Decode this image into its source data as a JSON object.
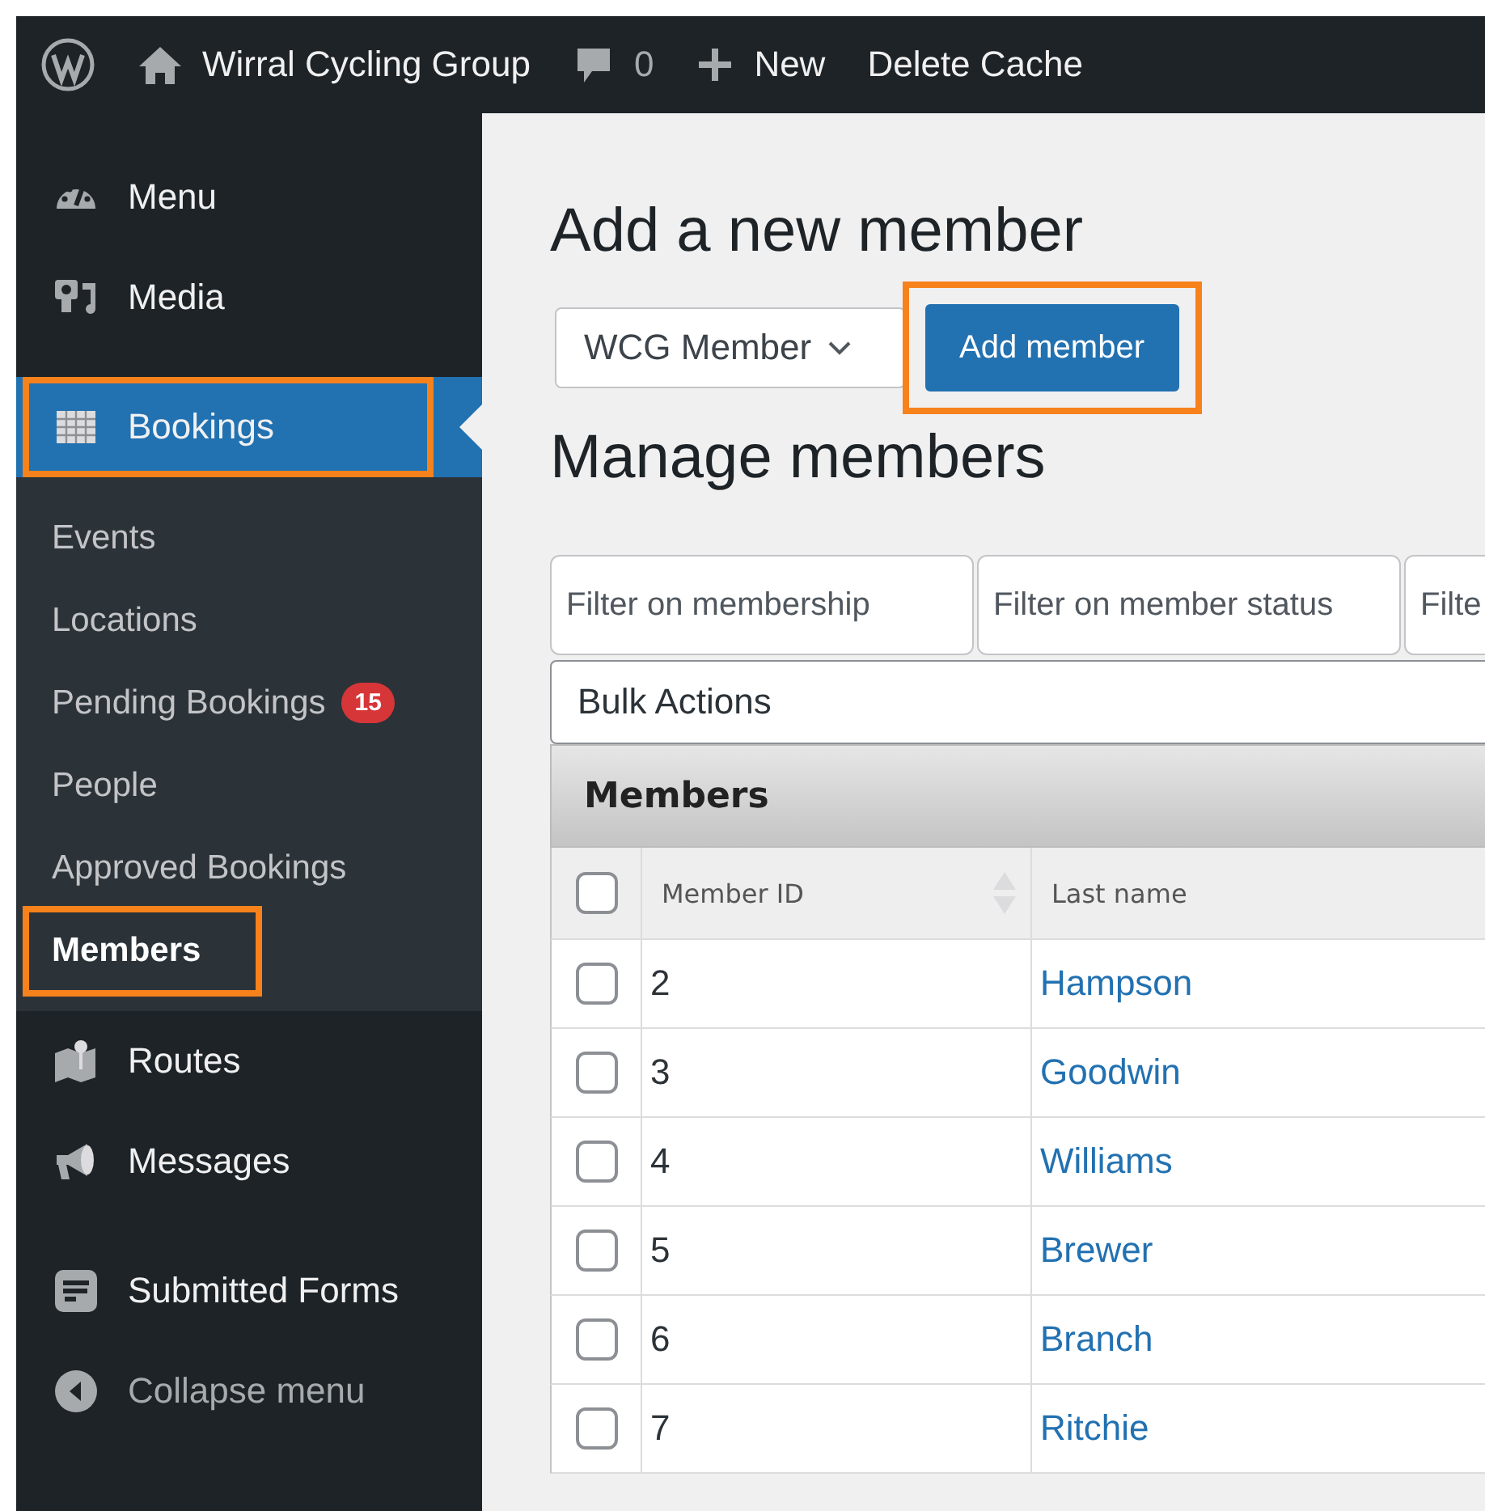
{
  "admin_bar": {
    "site": "Wirral Cycling Group",
    "comments": "0",
    "new_label": "New",
    "cache_label": "Delete Cache"
  },
  "sidebar": {
    "groups": [
      {
        "items": [
          {
            "label": "Menu",
            "selected": false,
            "highlighted": false
          },
          {
            "label": "Media",
            "selected": false,
            "highlighted": false
          }
        ]
      },
      {
        "items": [
          {
            "label": "Bookings",
            "selected": true,
            "highlighted": true,
            "children": [
              {
                "label": "Events",
                "selected": false,
                "highlighted": false
              },
              {
                "label": "Locations",
                "selected": false,
                "highlighted": false
              },
              {
                "label": "Pending Bookings",
                "selected": false,
                "highlighted": false,
                "badge": "15"
              },
              {
                "label": "People",
                "selected": false,
                "highlighted": false
              },
              {
                "label": "Approved Bookings",
                "selected": false,
                "highlighted": false
              },
              {
                "label": "Members",
                "selected": true,
                "highlighted": true
              }
            ]
          },
          {
            "label": "Routes",
            "selected": false,
            "highlighted": false
          },
          {
            "label": "Messages",
            "selected": false,
            "highlighted": false
          }
        ]
      },
      {
        "items": [
          {
            "label": "Submitted Forms",
            "selected": false,
            "highlighted": false
          }
        ]
      }
    ],
    "collapse_label": "Collapse menu"
  },
  "add_section": {
    "title": "Add a new member",
    "select_value": "WCG Member",
    "button": "Add member",
    "button_highlighted": true
  },
  "manage_section": {
    "title": "Manage members",
    "filters": [
      {
        "placeholder": "Filter on membership"
      },
      {
        "placeholder": "Filter on member status"
      },
      {
        "placeholder": "Filte"
      }
    ],
    "bulk_actions": "Bulk Actions",
    "table": {
      "title": "Members",
      "select_all_checked": false,
      "columns": [
        "Member ID",
        "Last name"
      ],
      "rows": [
        {
          "checked": false,
          "id": "2",
          "last_name": "Hampson"
        },
        {
          "checked": false,
          "id": "3",
          "last_name": "Goodwin"
        },
        {
          "checked": false,
          "id": "4",
          "last_name": "Williams"
        },
        {
          "checked": false,
          "id": "5",
          "last_name": "Brewer"
        },
        {
          "checked": false,
          "id": "6",
          "last_name": "Branch"
        },
        {
          "checked": false,
          "id": "7",
          "last_name": "Ritchie"
        }
      ]
    }
  }
}
